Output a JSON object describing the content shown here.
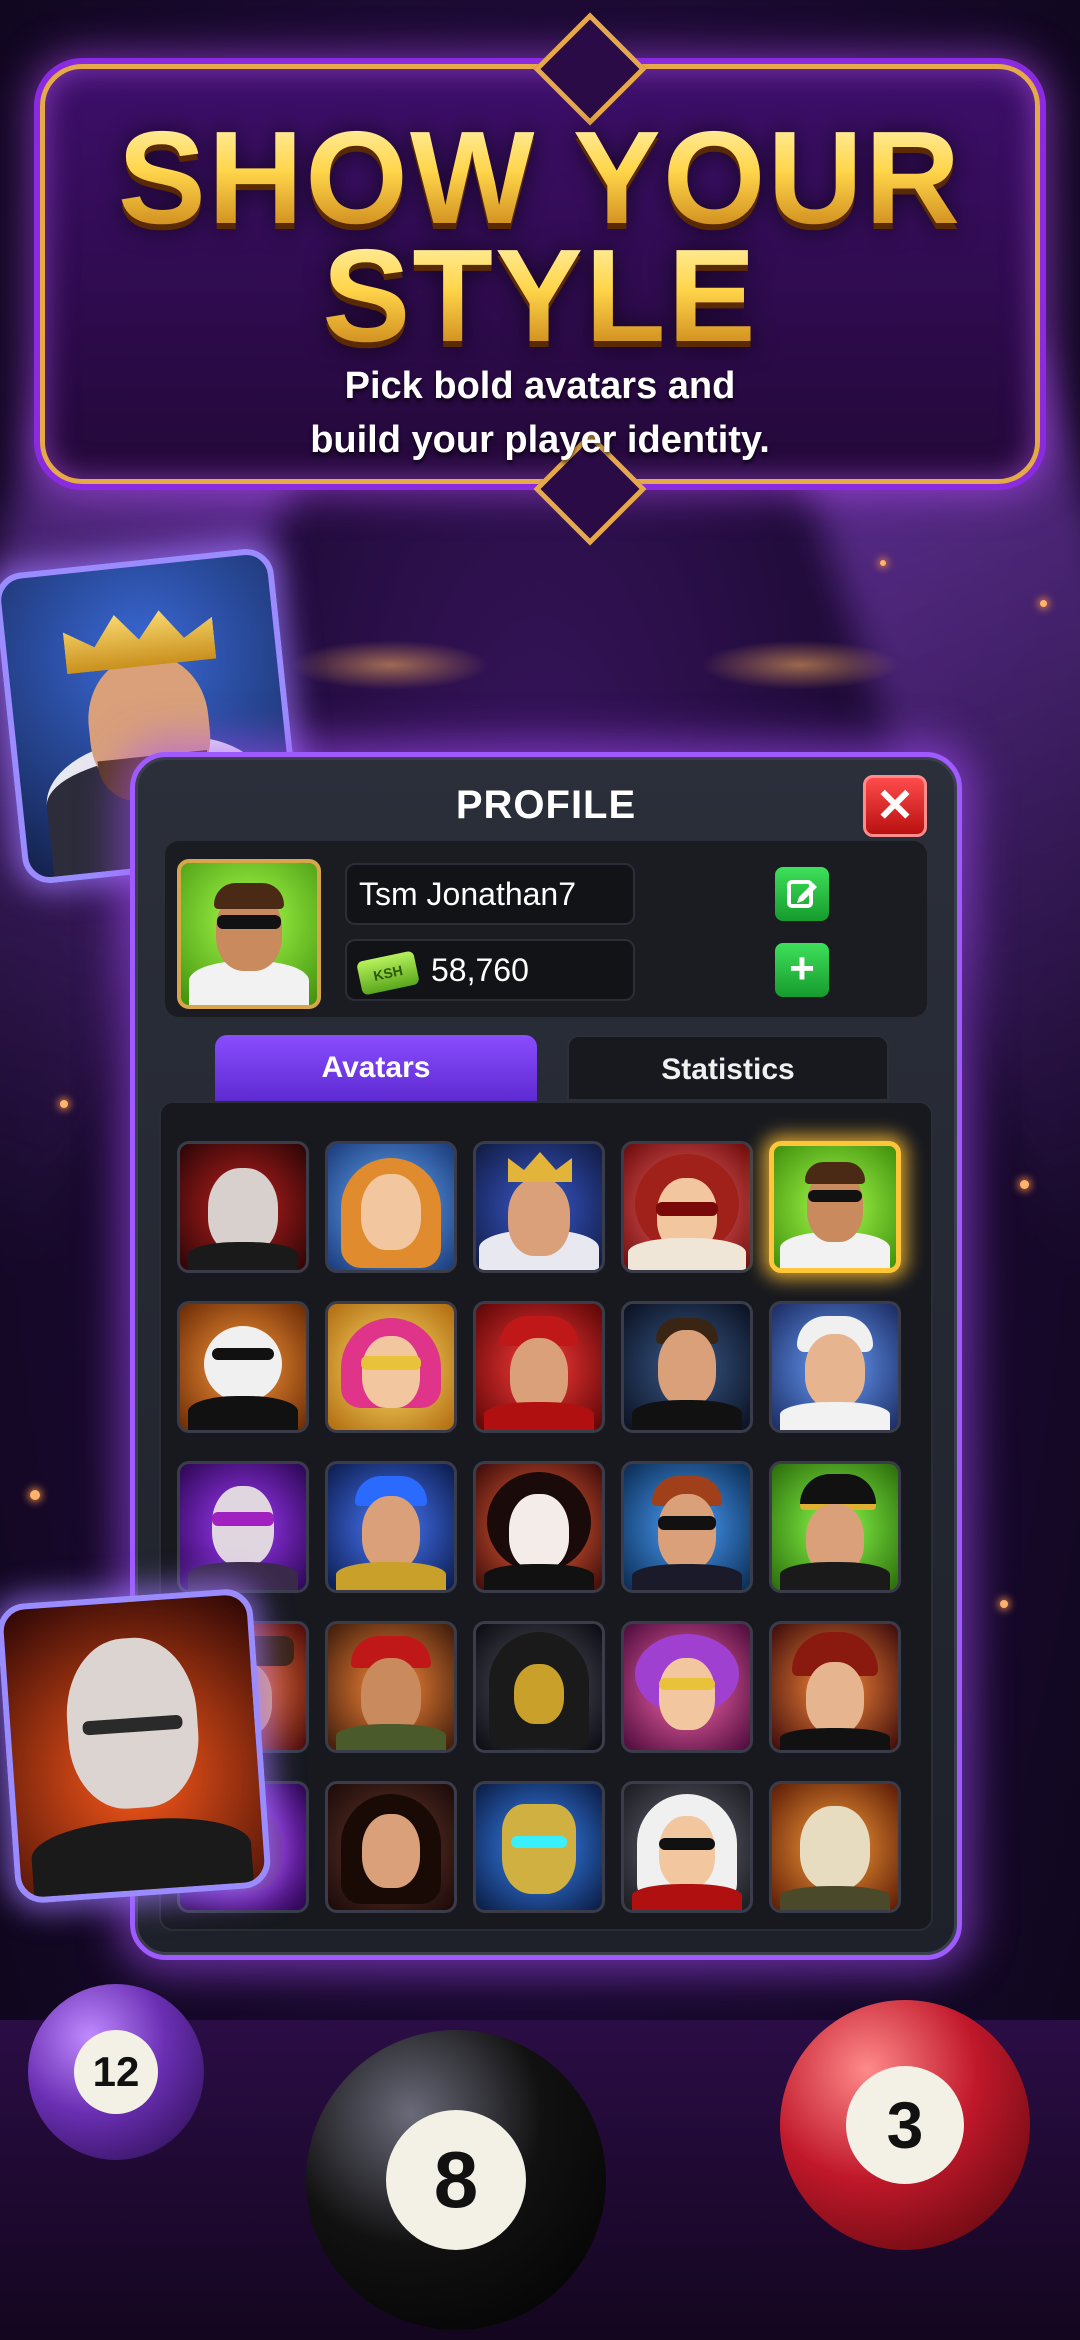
{
  "banner": {
    "title_line1": "SHOW YOUR",
    "title_line2": "STYLE",
    "subtitle_line1": "Pick bold avatars and",
    "subtitle_line2": "build your player identity."
  },
  "profile": {
    "title": "PROFILE",
    "close_icon": "✕",
    "username": "Tsm Jonathan7",
    "currency_badge": "KSH",
    "balance": "58,760",
    "edit_icon": "edit-icon",
    "add_icon": "+"
  },
  "tabs": [
    {
      "label": "Avatars",
      "active": true
    },
    {
      "label": "Statistics",
      "active": false
    }
  ],
  "balls": [
    {
      "number": "12",
      "color": "#6a2fb3"
    },
    {
      "number": "8",
      "color": "#111111"
    },
    {
      "number": "3",
      "color": "#c0182a"
    }
  ],
  "colors": {
    "accent_purple": "#9f5bff",
    "gold": "#ffc63a",
    "green_button": "#2bc745",
    "close_red": "#d52020"
  }
}
